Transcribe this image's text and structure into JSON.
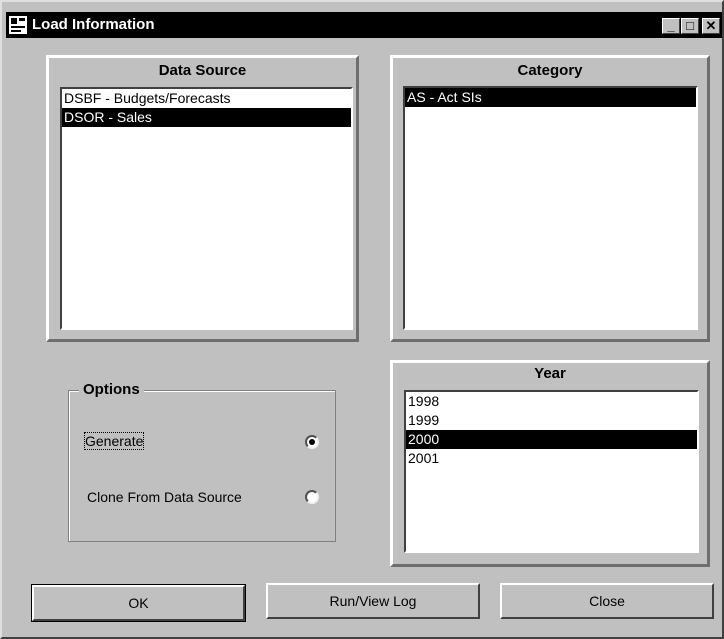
{
  "window": {
    "title": "Load Information",
    "minimize": "_",
    "maximize": "□",
    "close": "✕"
  },
  "data_source": {
    "heading": "Data Source",
    "items": [
      {
        "label": "DSBF - Budgets/Forecasts",
        "selected": false
      },
      {
        "label": "DSOR - Sales",
        "selected": true
      }
    ]
  },
  "category": {
    "heading": "Category",
    "items": [
      {
        "label": "AS - Act SIs",
        "selected": true
      }
    ]
  },
  "options": {
    "legend": "Options",
    "generate_label": "Generate",
    "generate_checked": true,
    "clone_label": "Clone From Data Source",
    "clone_checked": false
  },
  "year": {
    "heading": "Year",
    "items": [
      {
        "label": "1998",
        "selected": false
      },
      {
        "label": "1999",
        "selected": false
      },
      {
        "label": "2000",
        "selected": true
      },
      {
        "label": "2001",
        "selected": false
      }
    ]
  },
  "buttons": {
    "ok": "OK",
    "run_view_log": "Run/View Log",
    "close": "Close"
  },
  "colors": {
    "window_bg": "#c0c0c0",
    "titlebar_bg": "#000000",
    "selection_bg": "#000000"
  }
}
